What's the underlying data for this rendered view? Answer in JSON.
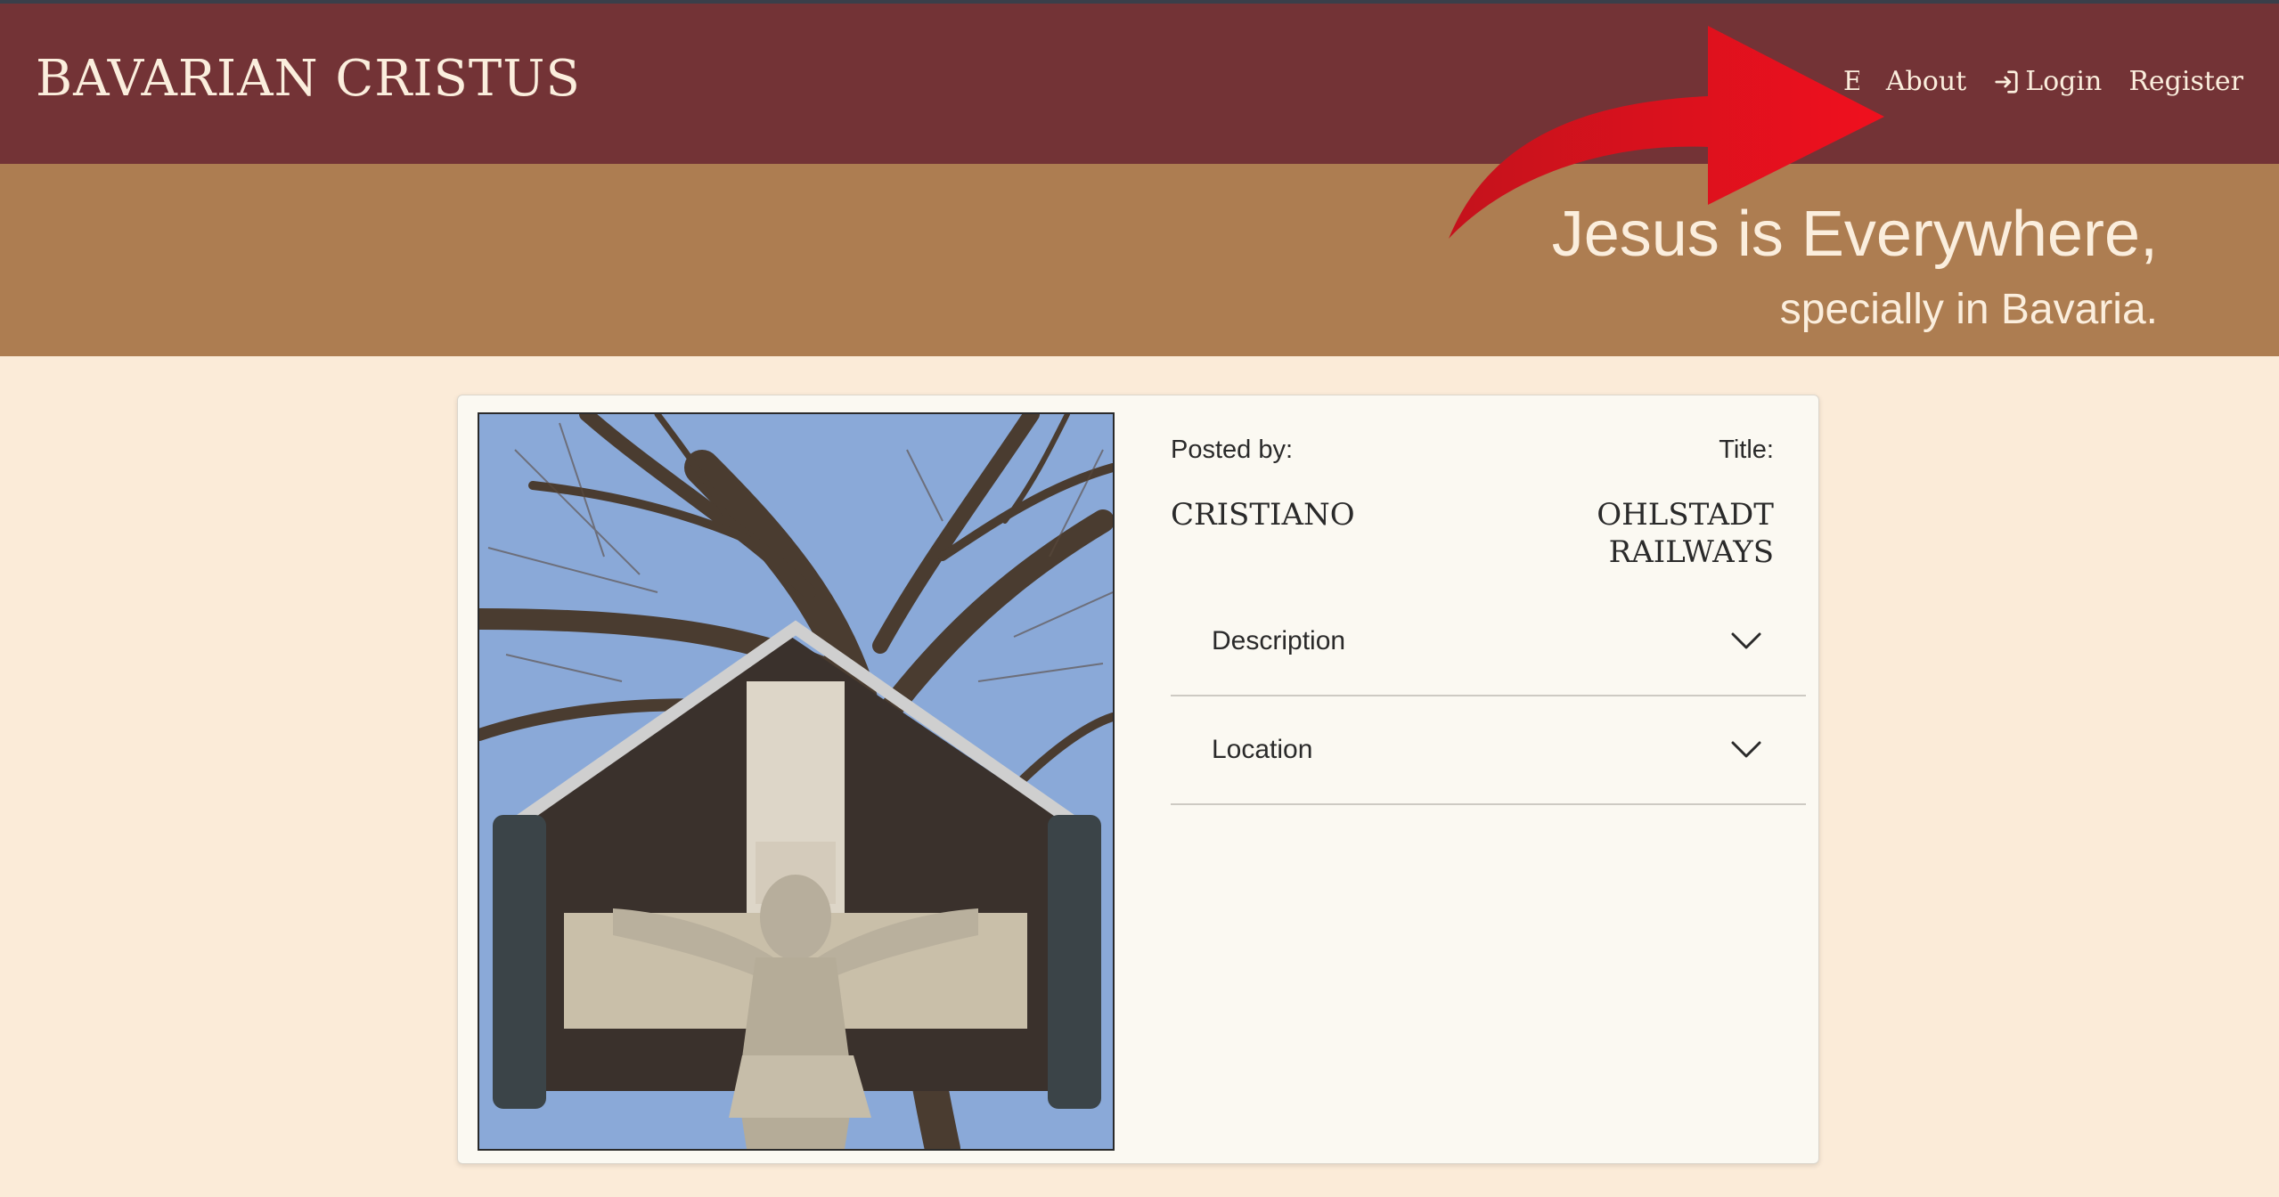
{
  "brand": "Bavarian Cristus",
  "nav": {
    "partial": "E",
    "about": "About",
    "login": "Login",
    "register": "Register"
  },
  "hero": {
    "line1": "Jesus is Everywhere,",
    "line2": "specially in Bavaria."
  },
  "post": {
    "posted_by_label": "Posted by:",
    "posted_by": "Cristiano",
    "title_label": "Title:",
    "title_line1": "Ohlstadt",
    "title_line2": "Railways"
  },
  "accordion": {
    "description": "Description",
    "location": "Location"
  },
  "icons": {
    "login": "login-icon",
    "chevron": "chevron-down-icon",
    "arrow": "red-arrow-annotation"
  },
  "colors": {
    "navbar": "#733336",
    "hero": "#ad7d51",
    "page": "#fbebd8",
    "card": "#fbf9f2",
    "arrow": "#e01520"
  }
}
